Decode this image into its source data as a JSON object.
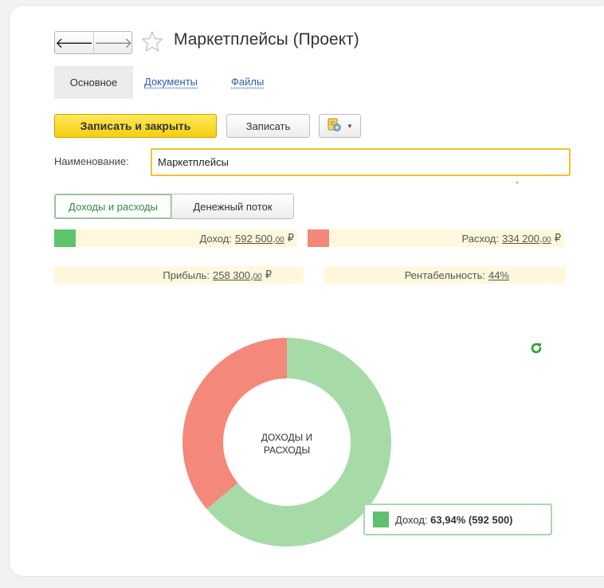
{
  "window": {
    "title": "Маркетплейсы (Проект)",
    "back_glyph": "🡐",
    "forward_glyph": "🡒"
  },
  "tabs": {
    "main": "Основное",
    "documents": "Документы",
    "files": "Файлы"
  },
  "toolbar": {
    "save_close_label": "Записать и закрыть",
    "save_label": "Записать",
    "extra_icon": "report-settings-icon"
  },
  "name_field": {
    "label": "Наименование:",
    "value": "Маркетплейсы"
  },
  "view_switch": {
    "items": [
      "Доходы и расходы",
      "Денежный поток"
    ],
    "active": "Доходы и расходы"
  },
  "summary": {
    "income": {
      "label": "Доход:",
      "main": "592 500,",
      "cents": "00",
      "currency": "₽",
      "color": "#5cc46b"
    },
    "expense": {
      "label": "Расход:",
      "main": "334 200,",
      "cents": "00",
      "currency": "₽",
      "color": "#f3877a"
    },
    "profit": {
      "label": "Прибыль:",
      "main": "258 300,",
      "cents": "00",
      "currency": "₽"
    },
    "profitability": {
      "label": "Рентабельность:",
      "value": "44%"
    }
  },
  "chart_data": {
    "type": "pie",
    "title": "ДОХОДЫ И РАСХОДЫ",
    "categories": [
      "Доход",
      "Расход"
    ],
    "values": [
      592500,
      334200
    ],
    "colors": [
      "#a6dba8",
      "#f4887a"
    ],
    "donut": true,
    "tooltip": {
      "series": "Доход:",
      "value": "63,94% (592 500)"
    }
  },
  "colors": {
    "accent_yellow": "#f4cf10",
    "link_blue": "#2f5aa8",
    "active_green": "#2e8b3d",
    "refresh_green": "#27a236"
  }
}
